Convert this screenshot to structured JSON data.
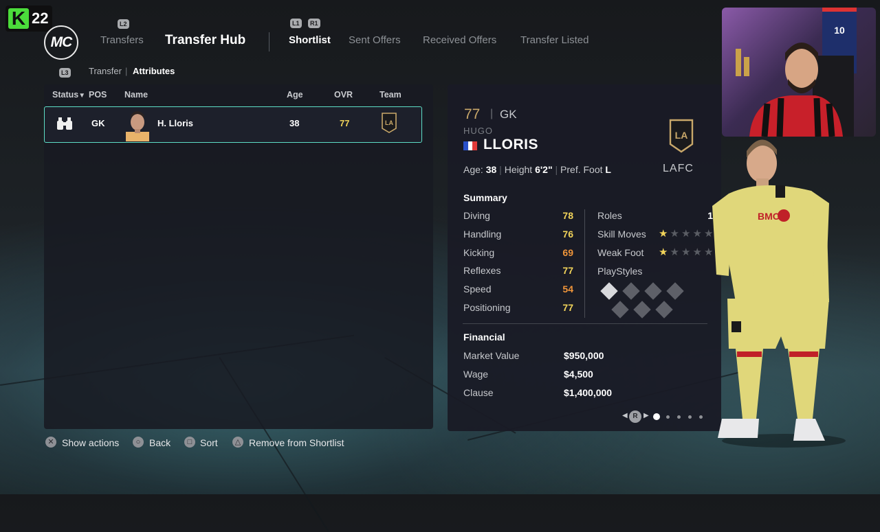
{
  "badge": {
    "letter": "K",
    "number": "22"
  },
  "logo": {
    "text": "MC"
  },
  "controller_hints": {
    "l2": "L2",
    "l1": "L1",
    "r1": "R1",
    "l3": "L3"
  },
  "nav": {
    "transfers": "Transfers",
    "transfer_hub": "Transfer Hub",
    "shortlist": "Shortlist",
    "sent_offers": "Sent Offers",
    "received_offers": "Received Offers",
    "transfer_listed": "Transfer Listed"
  },
  "breadcrumb": {
    "first": "Transfer",
    "separator": "|",
    "second": "Attributes"
  },
  "table": {
    "headers": {
      "status": "Status",
      "sort_arrow": "▼",
      "pos": "POS",
      "name": "Name",
      "age": "Age",
      "ovr": "OVR",
      "team": "Team"
    },
    "rows": [
      {
        "pos": "GK",
        "name": "H. Lloris",
        "age": "38",
        "ovr": "77",
        "team_badge": "LAFC"
      }
    ]
  },
  "player": {
    "ovr": "77",
    "sep": "|",
    "pos": "GK",
    "first_name": "HUGO",
    "last_name": "LLORIS",
    "nationality_flag": "france-flag",
    "age_label": "Age:",
    "age": "38",
    "height_label": "Height",
    "height": "6'2\"",
    "foot_label": "Pref. Foot",
    "foot": "L",
    "team": "LAFC",
    "summary_heading": "Summary",
    "stats": [
      {
        "label": "Diving",
        "value": "78",
        "color": "#f2d45a"
      },
      {
        "label": "Handling",
        "value": "76",
        "color": "#f2d45a"
      },
      {
        "label": "Kicking",
        "value": "69",
        "color": "#f0953a"
      },
      {
        "label": "Reflexes",
        "value": "77",
        "color": "#f2d45a"
      },
      {
        "label": "Speed",
        "value": "54",
        "color": "#f0953a"
      },
      {
        "label": "Positioning",
        "value": "77",
        "color": "#f2d45a"
      }
    ],
    "roles_label": "Roles",
    "roles_value": "1",
    "skill_moves_label": "Skill Moves",
    "skill_moves_stars": 1,
    "weak_foot_label": "Weak Foot",
    "weak_foot_stars": 1,
    "playstyles_label": "PlayStyles",
    "financial_heading": "Financial",
    "financial": [
      {
        "label": "Market Value",
        "value": "$950,000"
      },
      {
        "label": "Wage",
        "value": "$4,500"
      },
      {
        "label": "Clause",
        "value": "$1,400,000"
      }
    ],
    "page_indicator": {
      "button": "R",
      "pages": 5,
      "current": 1
    }
  },
  "kit": {
    "sponsor": "BMO",
    "back_number": "10"
  },
  "bottom_hints": [
    {
      "icon": "cross-button-icon",
      "glyph": "✕",
      "label": "Show actions"
    },
    {
      "icon": "circle-button-icon",
      "glyph": "○",
      "label": "Back"
    },
    {
      "icon": "square-button-icon",
      "glyph": "□",
      "label": "Sort"
    },
    {
      "icon": "triangle-button-icon",
      "glyph": "△",
      "label": "Remove from Shortlist"
    }
  ],
  "colors": {
    "accent_teal": "#5ee0c8",
    "gold": "#c9a86a",
    "stat_yellow": "#f2d45a",
    "stat_orange": "#f0953a"
  }
}
